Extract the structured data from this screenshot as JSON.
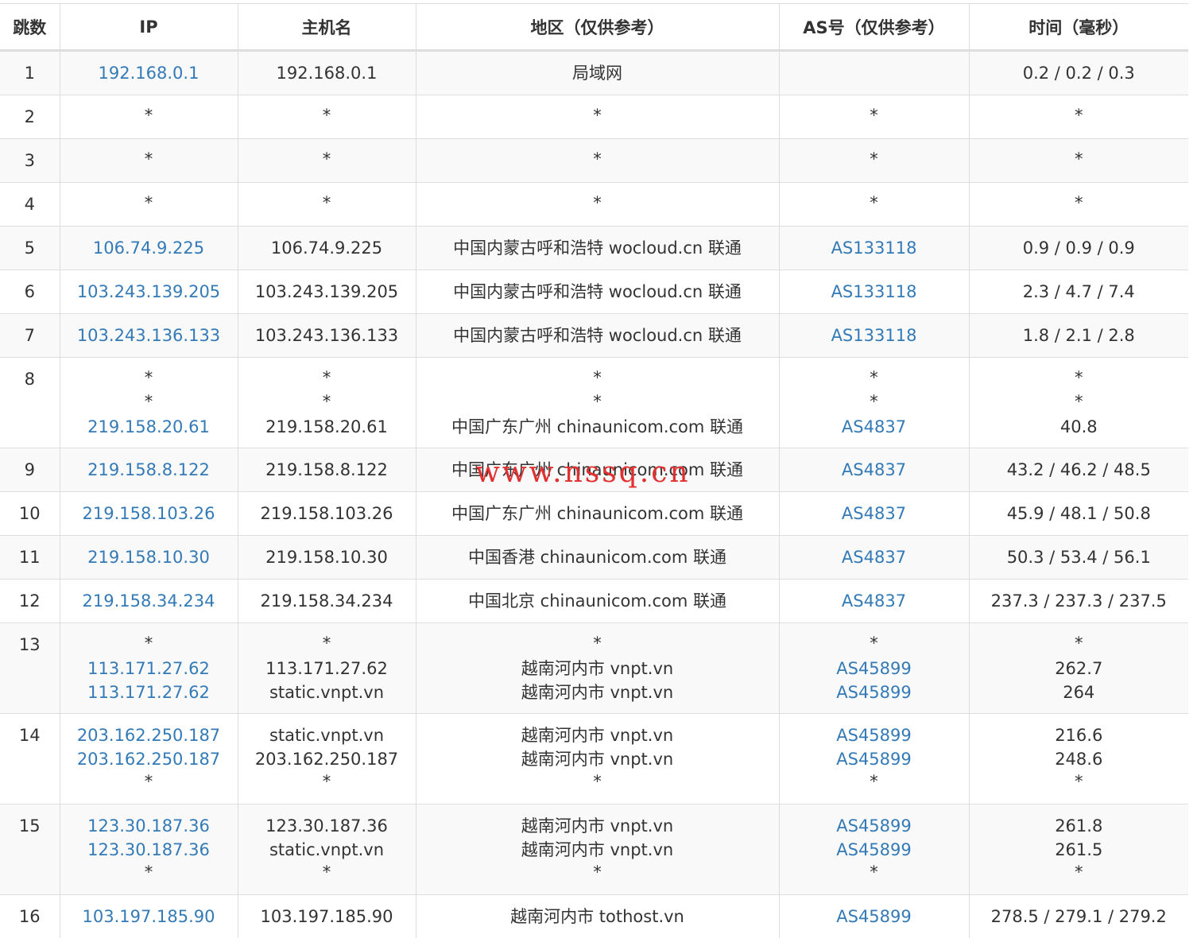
{
  "headers": [
    "跳数",
    "IP",
    "主机名",
    "地区（仅供参考）",
    "AS号（仅供参考）",
    "时间（毫秒）"
  ],
  "rows": [
    {
      "hop": "1",
      "ip": [
        "192.168.0.1"
      ],
      "host": [
        "192.168.0.1"
      ],
      "region": [
        "局域网"
      ],
      "as": [
        ""
      ],
      "time": [
        "0.2 / 0.2 / 0.3"
      ]
    },
    {
      "hop": "2",
      "ip": [
        "*"
      ],
      "host": [
        "*"
      ],
      "region": [
        "*"
      ],
      "as": [
        "*"
      ],
      "time": [
        "*"
      ]
    },
    {
      "hop": "3",
      "ip": [
        "*"
      ],
      "host": [
        "*"
      ],
      "region": [
        "*"
      ],
      "as": [
        "*"
      ],
      "time": [
        "*"
      ]
    },
    {
      "hop": "4",
      "ip": [
        "*"
      ],
      "host": [
        "*"
      ],
      "region": [
        "*"
      ],
      "as": [
        "*"
      ],
      "time": [
        "*"
      ]
    },
    {
      "hop": "5",
      "ip": [
        "106.74.9.225"
      ],
      "host": [
        "106.74.9.225"
      ],
      "region": [
        "中国内蒙古呼和浩特 wocloud.cn 联通"
      ],
      "as": [
        "AS133118"
      ],
      "time": [
        "0.9 / 0.9 / 0.9"
      ]
    },
    {
      "hop": "6",
      "ip": [
        "103.243.139.205"
      ],
      "host": [
        "103.243.139.205"
      ],
      "region": [
        "中国内蒙古呼和浩特 wocloud.cn 联通"
      ],
      "as": [
        "AS133118"
      ],
      "time": [
        "2.3 / 4.7 / 7.4"
      ]
    },
    {
      "hop": "7",
      "ip": [
        "103.243.136.133"
      ],
      "host": [
        "103.243.136.133"
      ],
      "region": [
        "中国内蒙古呼和浩特 wocloud.cn 联通"
      ],
      "as": [
        "AS133118"
      ],
      "time": [
        "1.8 / 2.1 / 2.8"
      ]
    },
    {
      "hop": "8",
      "ip": [
        "*",
        "*",
        "219.158.20.61"
      ],
      "host": [
        "*",
        "*",
        "219.158.20.61"
      ],
      "region": [
        "*",
        "*",
        "中国广东广州 chinaunicom.com 联通"
      ],
      "as": [
        "*",
        "*",
        "AS4837"
      ],
      "time": [
        "*",
        "*",
        "40.8"
      ]
    },
    {
      "hop": "9",
      "ip": [
        "219.158.8.122"
      ],
      "host": [
        "219.158.8.122"
      ],
      "region": [
        "中国广东广州 chinaunicom.com 联通"
      ],
      "as": [
        "AS4837"
      ],
      "time": [
        "43.2 / 46.2 / 48.5"
      ]
    },
    {
      "hop": "10",
      "ip": [
        "219.158.103.26"
      ],
      "host": [
        "219.158.103.26"
      ],
      "region": [
        "中国广东广州 chinaunicom.com 联通"
      ],
      "as": [
        "AS4837"
      ],
      "time": [
        "45.9 / 48.1 / 50.8"
      ]
    },
    {
      "hop": "11",
      "ip": [
        "219.158.10.30"
      ],
      "host": [
        "219.158.10.30"
      ],
      "region": [
        "中国香港 chinaunicom.com 联通"
      ],
      "as": [
        "AS4837"
      ],
      "time": [
        "50.3 / 53.4 / 56.1"
      ]
    },
    {
      "hop": "12",
      "ip": [
        "219.158.34.234"
      ],
      "host": [
        "219.158.34.234"
      ],
      "region": [
        "中国北京 chinaunicom.com 联通"
      ],
      "as": [
        "AS4837"
      ],
      "time": [
        "237.3 / 237.3 / 237.5"
      ]
    },
    {
      "hop": "13",
      "ip": [
        "*",
        "113.171.27.62",
        "113.171.27.62"
      ],
      "host": [
        "*",
        "113.171.27.62",
        "static.vnpt.vn"
      ],
      "region": [
        "*",
        "越南河内市 vnpt.vn",
        "越南河内市 vnpt.vn"
      ],
      "as": [
        "*",
        "AS45899",
        "AS45899"
      ],
      "time": [
        "*",
        "262.7",
        "264"
      ]
    },
    {
      "hop": "14",
      "ip": [
        "203.162.250.187",
        "203.162.250.187",
        "*"
      ],
      "host": [
        "static.vnpt.vn",
        "203.162.250.187",
        "*"
      ],
      "region": [
        "越南河内市 vnpt.vn",
        "越南河内市 vnpt.vn",
        "*"
      ],
      "as": [
        "AS45899",
        "AS45899",
        "*"
      ],
      "time": [
        "216.6",
        "248.6",
        "*"
      ]
    },
    {
      "hop": "15",
      "ip": [
        "123.30.187.36",
        "123.30.187.36",
        "*"
      ],
      "host": [
        "123.30.187.36",
        "static.vnpt.vn",
        "*"
      ],
      "region": [
        "越南河内市 vnpt.vn",
        "越南河内市 vnpt.vn",
        "*"
      ],
      "as": [
        "AS45899",
        "AS45899",
        "*"
      ],
      "time": [
        "261.8",
        "261.5",
        "*"
      ]
    },
    {
      "hop": "16",
      "ip": [
        "103.197.185.90"
      ],
      "host": [
        "103.197.185.90"
      ],
      "region": [
        "越南河内市 tothost.vn"
      ],
      "as": [
        "AS45899"
      ],
      "time": [
        "278.5 / 279.1 / 279.2"
      ]
    }
  ],
  "watermark": "www.nssq.cn",
  "colors": {
    "link": "#337ab7",
    "text": "#333333",
    "border": "#dddddd",
    "stripe": "#f9f9f9",
    "watermark": "#e03030"
  }
}
